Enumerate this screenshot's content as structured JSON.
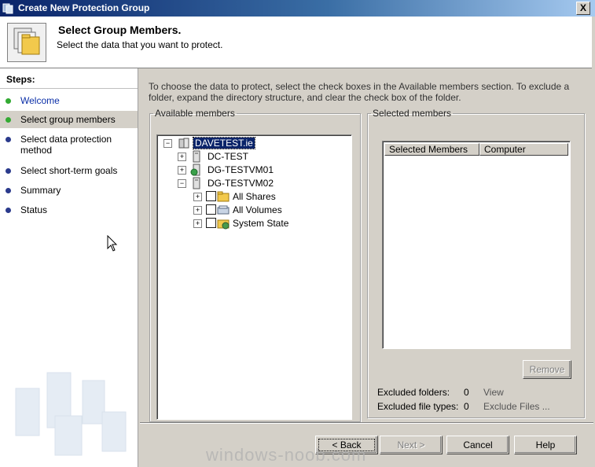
{
  "window": {
    "title": "Create New Protection Group",
    "close_glyph": "X"
  },
  "header": {
    "title": "Select Group Members.",
    "subtitle": "Select the data that you want to protect."
  },
  "steps": {
    "title": "Steps:",
    "items": [
      {
        "label": "Welcome",
        "state": "done"
      },
      {
        "label": "Select group members",
        "state": "current"
      },
      {
        "label": "Select data protection method",
        "state": "pending"
      },
      {
        "label": "Select short-term goals",
        "state": "pending"
      },
      {
        "label": "Summary",
        "state": "pending"
      },
      {
        "label": "Status",
        "state": "pending"
      }
    ]
  },
  "instructions": "To choose the data to protect, select the check boxes in the Available members section. To exclude a folder, expand the directory structure, and clear the check box of the folder.",
  "available": {
    "legend": "Available members",
    "tree": [
      {
        "label": "DAVETEST.ie",
        "icon": "domain-icon",
        "expander": "−",
        "selected": true
      },
      {
        "label": "DC-TEST",
        "icon": "server-icon",
        "expander": "+"
      },
      {
        "label": "DG-TESTVM01",
        "icon": "server-protected-icon",
        "expander": "+"
      },
      {
        "label": "DG-TESTVM02",
        "icon": "server-icon",
        "expander": "−"
      },
      {
        "label": "All Shares",
        "icon": "shares-folder-icon",
        "expander": "+"
      },
      {
        "label": "All Volumes",
        "icon": "volumes-icon",
        "expander": "+"
      },
      {
        "label": "System State",
        "icon": "system-state-icon",
        "expander": "+"
      }
    ]
  },
  "selected": {
    "legend": "Selected members",
    "columns": [
      "Selected Members",
      "Computer"
    ],
    "remove_label": "Remove",
    "excluded_folders_label": "Excluded folders:",
    "excluded_folders_value": "0",
    "view_link": "View",
    "excluded_types_label": "Excluded file types:",
    "excluded_types_value": "0",
    "exclude_files_link": "Exclude Files ..."
  },
  "buttons": {
    "back": "< Back",
    "next": "Next >",
    "cancel": "Cancel",
    "help": "Help"
  },
  "watermark": "windows-noob.com",
  "colors": {
    "accent_bullet": "#33aa33",
    "pending_bullet": "#2a3a8c",
    "selection": "#0a246a"
  }
}
